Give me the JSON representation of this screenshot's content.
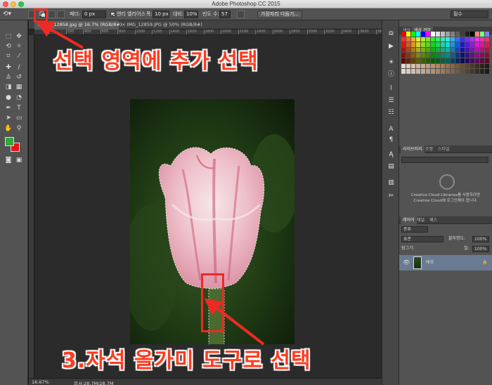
{
  "window": {
    "title": "Adobe Photoshop CC 2015"
  },
  "options_bar": {
    "feather_label": "페더:",
    "feather_value": "0 px",
    "antialias_label": "앤티 앨리어스",
    "width_label": "폭:",
    "width_value": "10 px",
    "contrast_label": "대비:",
    "contrast_value": "10%",
    "frequency_label": "빈도 수:",
    "frequency_value": "57",
    "refine_edge_button": "가장자리 다듬기...",
    "workspace_dropdown": "필수"
  },
  "document_tabs": [
    {
      "label": "IMG_12858.jpg @ 16.7% (RGB/8#)",
      "active": true
    },
    {
      "label": "IMG_12859.JPG @ 50% (RGB/8#)",
      "active": false
    }
  ],
  "ruler_ticks": [
    "0",
    "200",
    "400",
    "600",
    "800",
    "1000",
    "1200",
    "1400",
    "1600",
    "1800",
    "2000",
    "2200",
    "2400",
    "2600",
    "2800",
    "3000",
    "3200",
    "3400",
    "3600",
    "3800"
  ],
  "status_bar": {
    "zoom": "16.67%",
    "doc_size": "문서:28.7M/28.7M"
  },
  "panels": {
    "color_tabs": [
      "색상",
      "색상 견본"
    ],
    "library_tabs": [
      "라이브러리",
      "조정",
      "스타일"
    ],
    "cc_message_line1": "Creative Cloud Libraries를 사용하려면",
    "cc_message_line2": "Creative Cloud에 로그인해야 합니다.",
    "layer_tabs": [
      "레이어",
      "채널",
      "패스"
    ],
    "layer_filter": "종류",
    "blend_mode": "표준",
    "opacity_label": "불투명도:",
    "opacity_value": "100%",
    "lock_label": "잠그기:",
    "fill_label": "칠:",
    "fill_value": "100%",
    "layer_name": "배경"
  },
  "annotations": {
    "top_text": "선택 영역에 추가 선택",
    "bottom_text": "3.자석 올가미 도구로 선택",
    "color": "#ee2a24"
  },
  "colors": {
    "ui_panel": "#535353",
    "canvas_bg": "#282828",
    "foreground": "#34a83a",
    "background": "#e8141b",
    "selected_layer": "#6a7a92"
  }
}
